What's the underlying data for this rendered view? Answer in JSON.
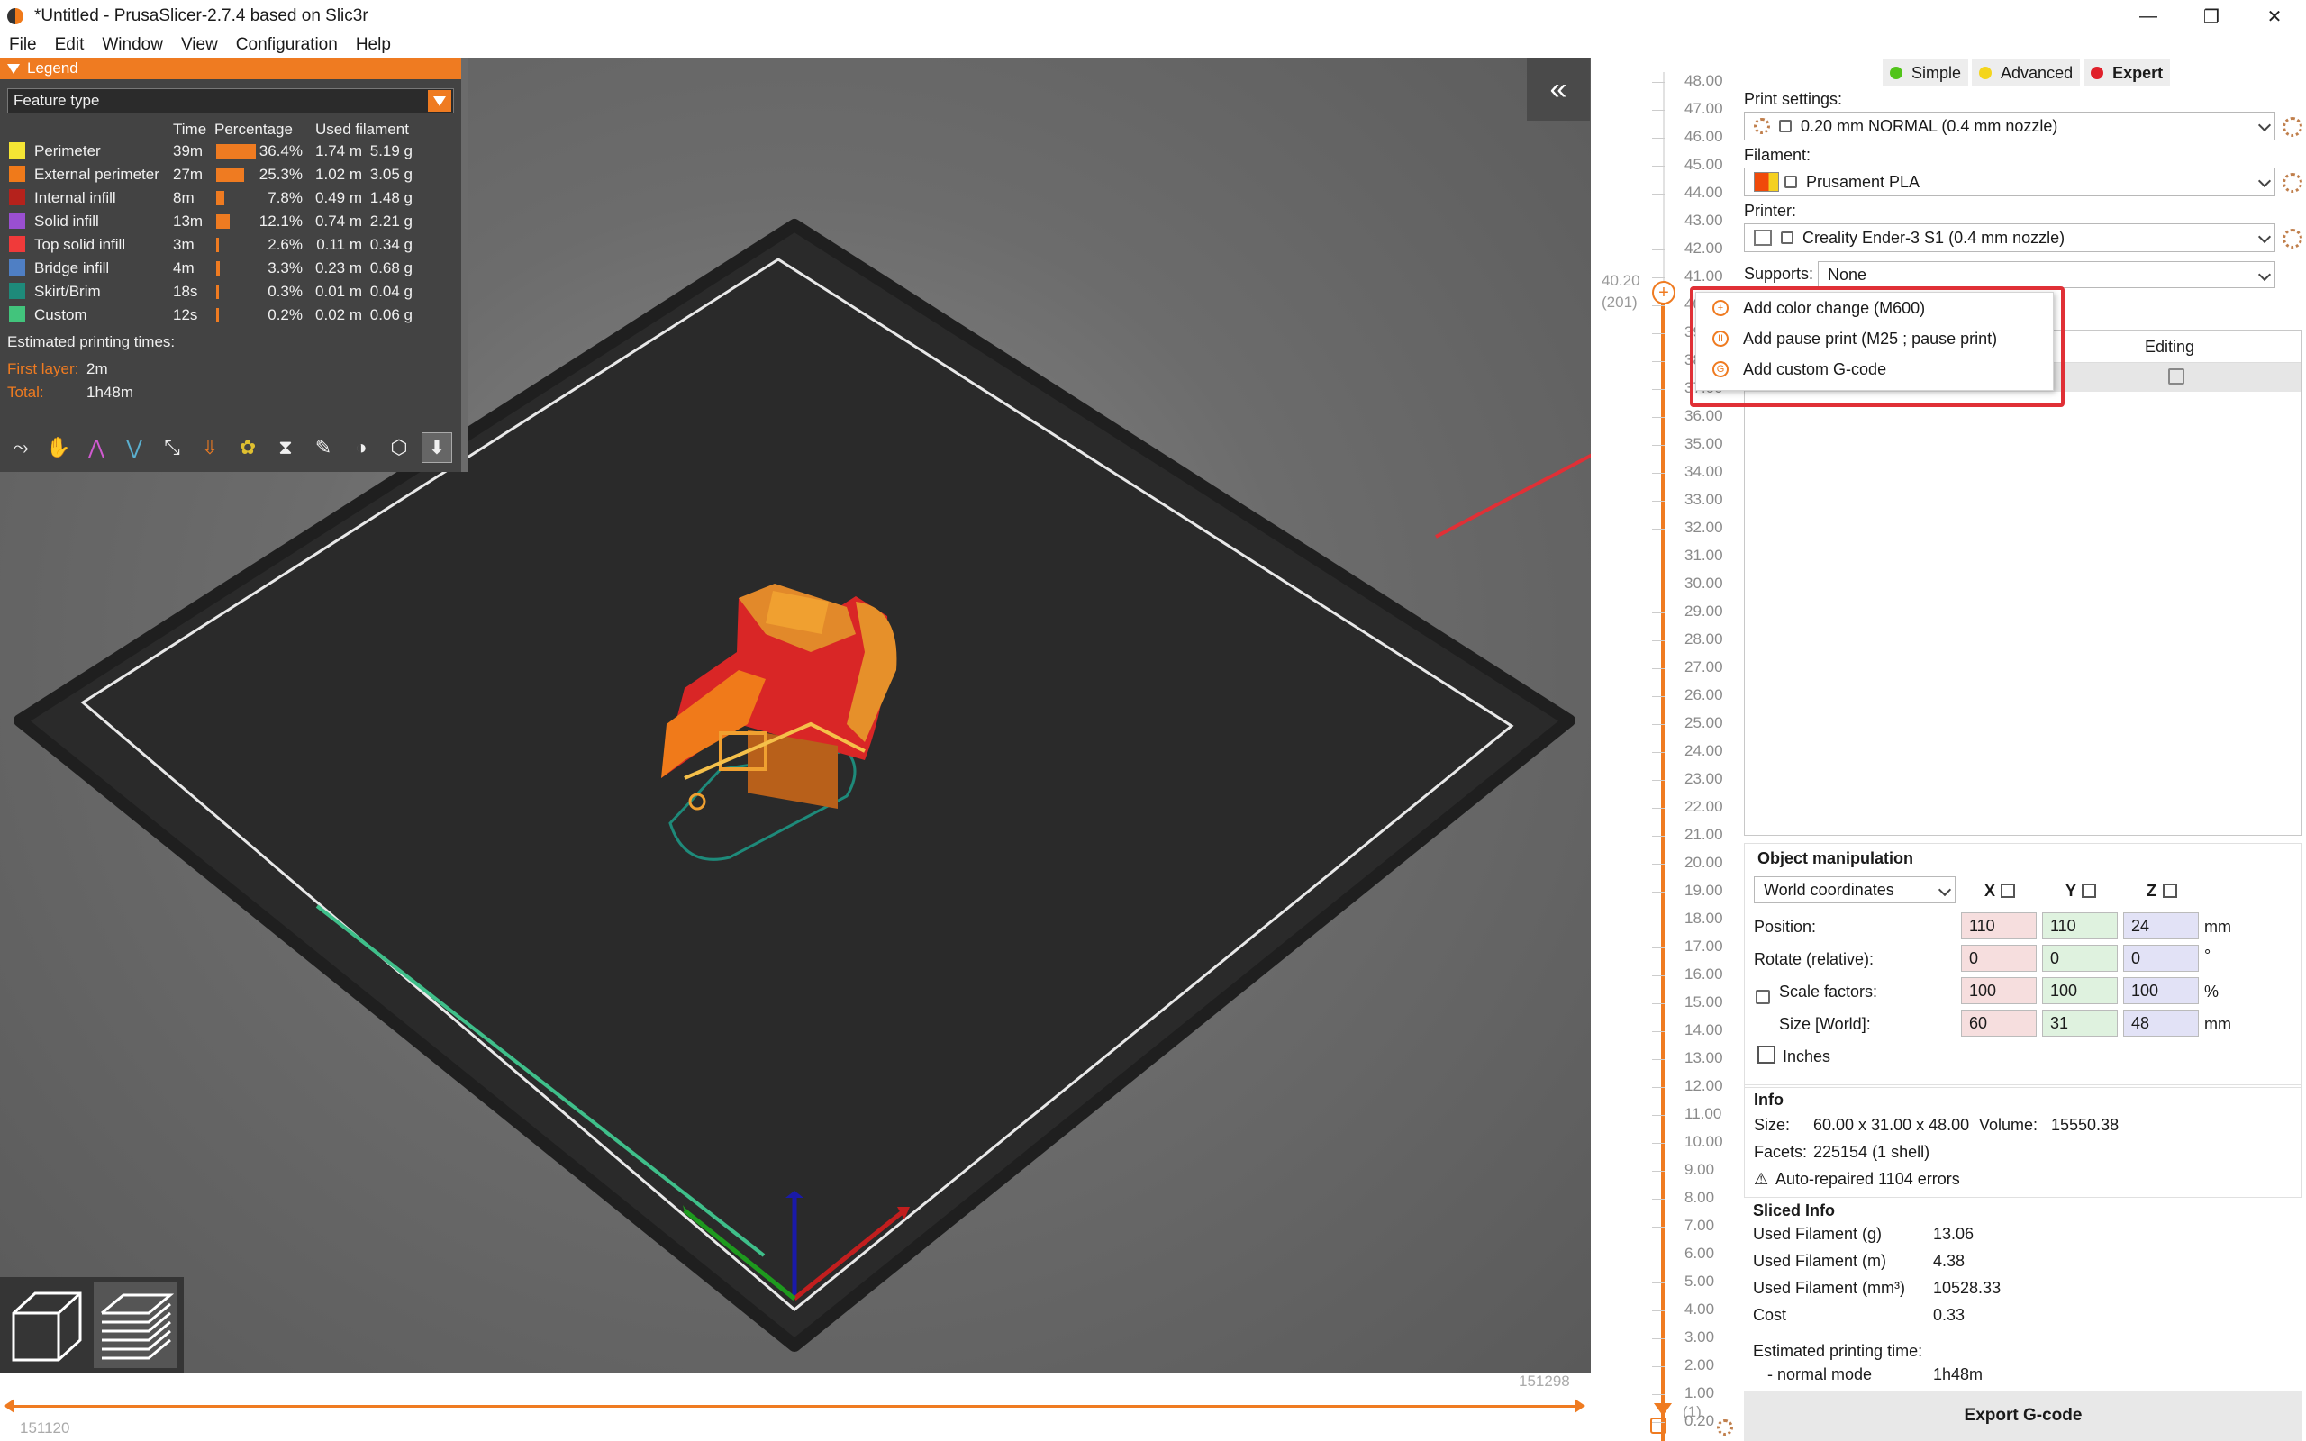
{
  "window": {
    "title": "*Untitled - PrusaSlicer-2.7.4 based on Slic3r",
    "minimize": "—",
    "restore": "❐",
    "close": "✕"
  },
  "menu": [
    "File",
    "Edit",
    "Window",
    "View",
    "Configuration",
    "Help"
  ],
  "legend": {
    "title": "Legend",
    "feature_type": "Feature type",
    "columns": {
      "time": "Time",
      "percentage": "Percentage",
      "filament": "Used filament"
    },
    "rows": [
      {
        "name": "Perimeter",
        "color": "#f5e534",
        "time": "39m",
        "pct": "36.4%",
        "pct_value": 36.4,
        "len": "1.74 m",
        "weight": "5.19 g"
      },
      {
        "name": "External perimeter",
        "color": "#f07a1a",
        "time": "27m",
        "pct": "25.3%",
        "pct_value": 25.3,
        "len": "1.02 m",
        "weight": "3.05 g"
      },
      {
        "name": "Internal infill",
        "color": "#b5221c",
        "time": "8m",
        "pct": "7.8%",
        "pct_value": 7.8,
        "len": "0.49 m",
        "weight": "1.48 g"
      },
      {
        "name": "Solid infill",
        "color": "#9a4fd1",
        "time": "13m",
        "pct": "12.1%",
        "pct_value": 12.1,
        "len": "0.74 m",
        "weight": "2.21 g"
      },
      {
        "name": "Top solid infill",
        "color": "#f03a3a",
        "time": "3m",
        "pct": "2.6%",
        "pct_value": 2.6,
        "len": "0.11 m",
        "weight": "0.34 g"
      },
      {
        "name": "Bridge infill",
        "color": "#4f7fc4",
        "time": "4m",
        "pct": "3.3%",
        "pct_value": 3.3,
        "len": "0.23 m",
        "weight": "0.68 g"
      },
      {
        "name": "Skirt/Brim",
        "color": "#1e8a7a",
        "time": "18s",
        "pct": "0.3%",
        "pct_value": 0.3,
        "len": "0.01 m",
        "weight": "0.04 g"
      },
      {
        "name": "Custom",
        "color": "#42c47c",
        "time": "12s",
        "pct": "0.2%",
        "pct_value": 0.2,
        "len": "0.02 m",
        "weight": "0.06 g"
      }
    ],
    "estimated_label": "Estimated printing times:",
    "first_layer_label": "First layer:",
    "first_layer_value": "2m",
    "total_label": "Total:",
    "total_value": "1h48m"
  },
  "horizontal_slider": {
    "left_value": "151120",
    "right_value": "151298"
  },
  "vertical_slider": {
    "ticks": [
      "48.00",
      "47.00",
      "46.00",
      "45.00",
      "44.00",
      "43.00",
      "42.00",
      "41.00",
      "40.00",
      "39.00",
      "38.00",
      "37.00",
      "36.00",
      "35.00",
      "34.00",
      "33.00",
      "32.00",
      "31.00",
      "30.00",
      "29.00",
      "28.00",
      "27.00",
      "26.00",
      "25.00",
      "24.00",
      "23.00",
      "22.00",
      "21.00",
      "20.00",
      "19.00",
      "18.00",
      "17.00",
      "16.00",
      "15.00",
      "14.00",
      "13.00",
      "12.00",
      "11.00",
      "10.00",
      "9.00",
      "8.00",
      "7.00",
      "6.00",
      "5.00",
      "4.00",
      "3.00",
      "2.00",
      "1.00",
      "0.20"
    ],
    "current_height": "40.20",
    "current_layer": "(201)",
    "bottom_layer": "(1)"
  },
  "context_menu": {
    "items": [
      {
        "label": "Add color change (M600)",
        "glyph": "+"
      },
      {
        "label": "Add pause print (M25 ; pause print)",
        "glyph": "II"
      },
      {
        "label": "Add custom G-code",
        "glyph": "G"
      }
    ]
  },
  "sidebar": {
    "modes": [
      {
        "label": "Simple",
        "color": "#52c41a"
      },
      {
        "label": "Advanced",
        "color": "#f4d51c"
      },
      {
        "label": "Expert",
        "color": "#e0202a"
      }
    ],
    "print_settings_label": "Print settings:",
    "print_settings_value": "0.20 mm NORMAL (0.4 mm nozzle)",
    "filament_label": "Filament:",
    "filament_value": "Prusament PLA",
    "printer_label": "Printer:",
    "printer_value": "Creality Ender-3 S1 (0.4 mm nozzle)",
    "supports_label": "Supports:",
    "supports_value": "None",
    "editing_header": "Editing"
  },
  "object_manipulation": {
    "title": "Object manipulation",
    "coordinates": "World coordinates",
    "axes": [
      "X",
      "Y",
      "Z"
    ],
    "position_label": "Position:",
    "position": [
      "110",
      "110",
      "24"
    ],
    "position_unit": "mm",
    "rotate_label": "Rotate (relative):",
    "rotate": [
      "0",
      "0",
      "0"
    ],
    "rotate_unit": "°",
    "scale_label": "Scale factors:",
    "scale": [
      "100",
      "100",
      "100"
    ],
    "scale_unit": "%",
    "size_label": "Size [World]:",
    "size": [
      "60",
      "31",
      "48"
    ],
    "size_unit": "mm",
    "inches_label": "Inches"
  },
  "info": {
    "title": "Info",
    "size_label": "Size:",
    "size_value": "60.00 x 31.00 x 48.00",
    "volume_label": "Volume:",
    "volume_value": "15550.38",
    "facets_label": "Facets:",
    "facets_value": "225154 (1 shell)",
    "repair": "Auto-repaired 1104 errors"
  },
  "sliced_info": {
    "title": "Sliced Info",
    "rows": [
      {
        "label": "Used Filament (g)",
        "value": "13.06"
      },
      {
        "label": "Used Filament (m)",
        "value": "4.38"
      },
      {
        "label": "Used Filament (mm³)",
        "value": "10528.33"
      },
      {
        "label": "Cost",
        "value": "0.33"
      }
    ],
    "est_label": "Estimated printing time:",
    "mode_label": "- normal mode",
    "mode_value": "1h48m"
  },
  "export_button": "Export G-code"
}
